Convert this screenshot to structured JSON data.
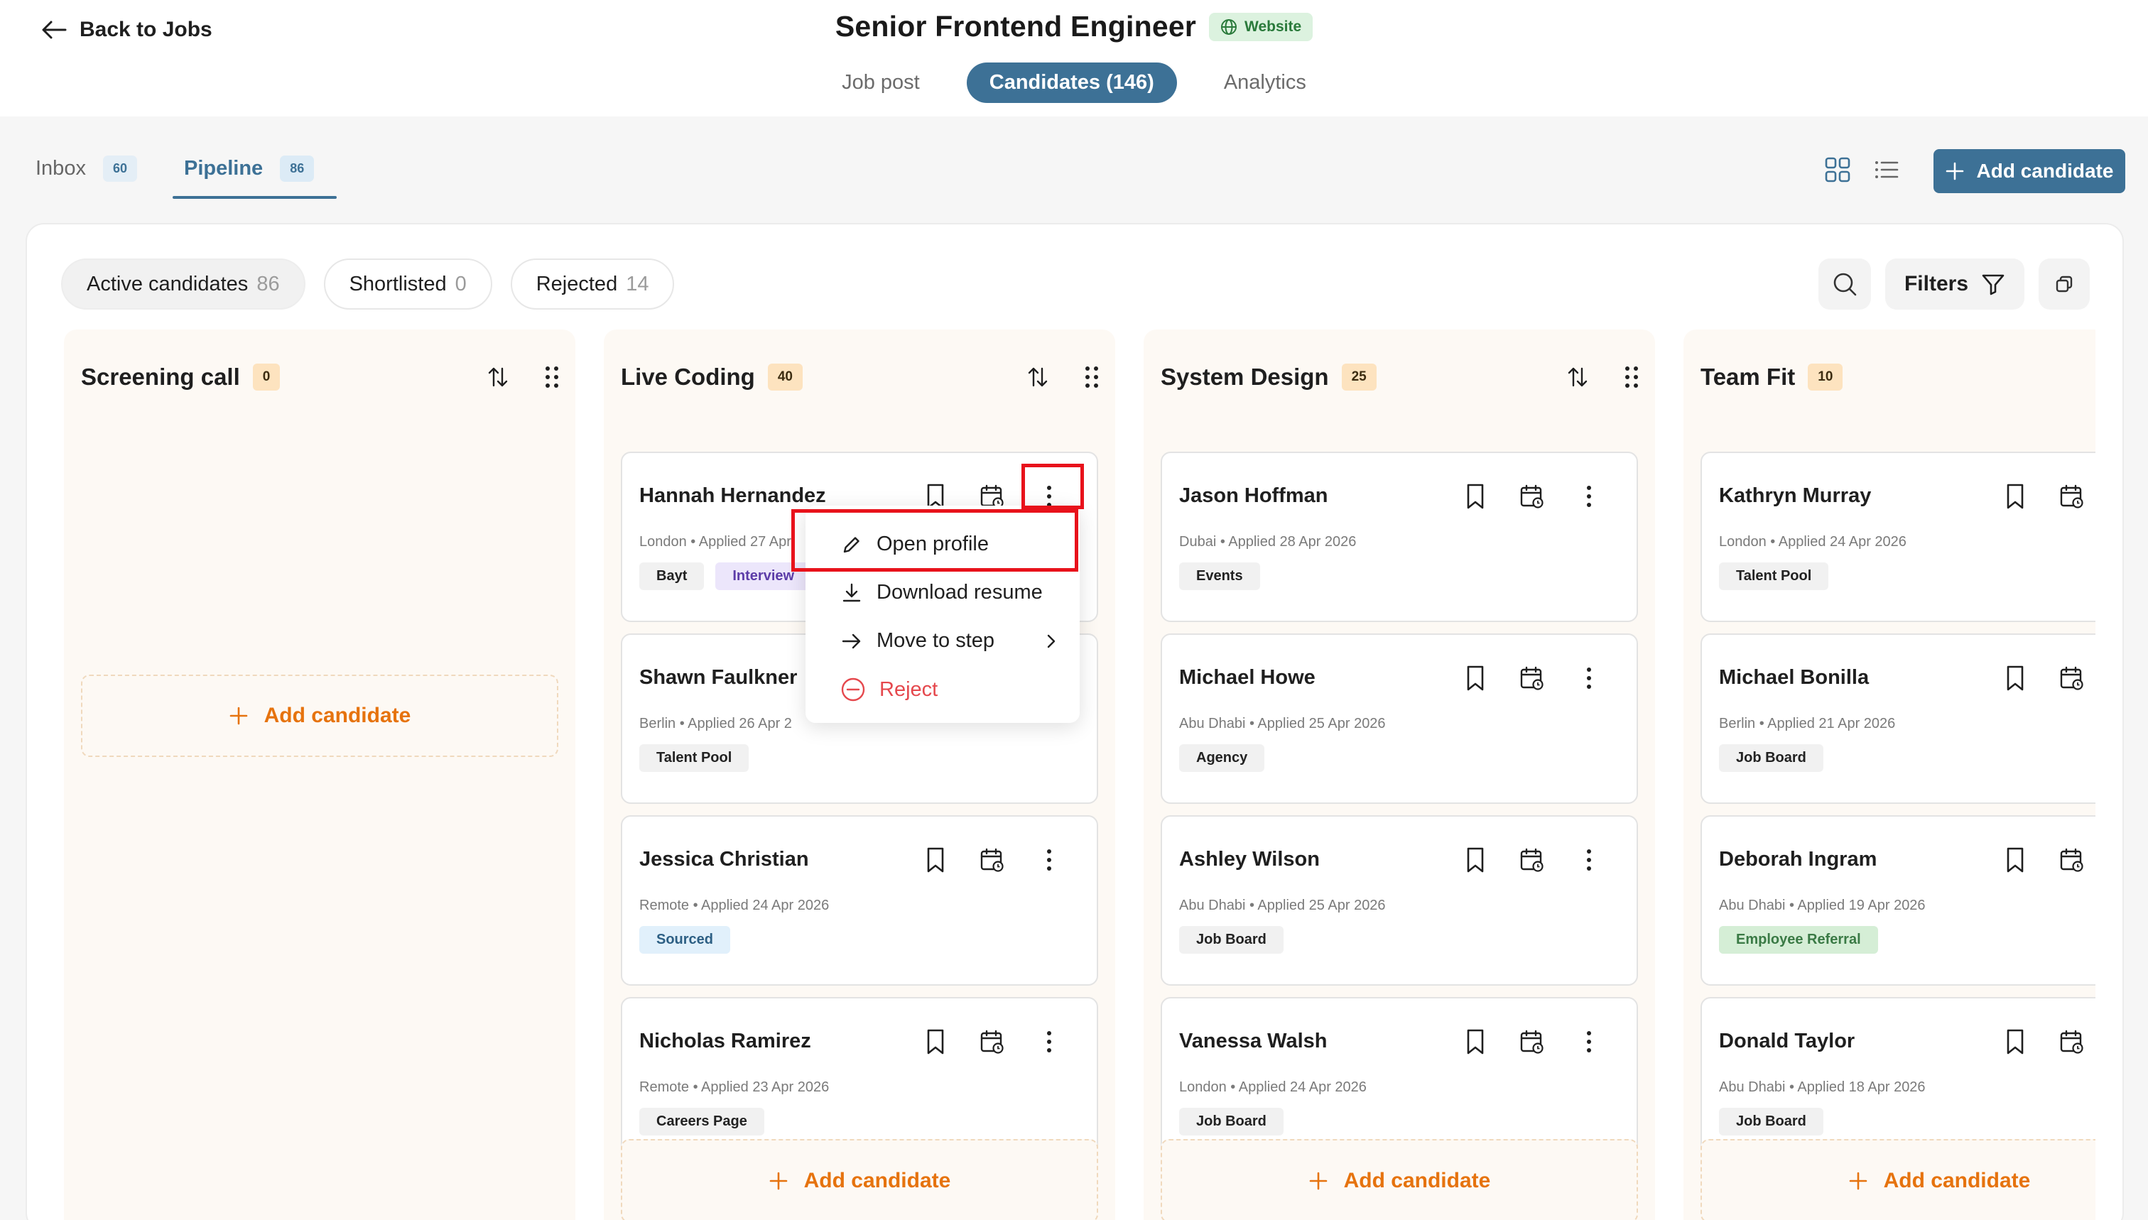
{
  "header": {
    "back_label": "Back to Jobs",
    "job_title": "Senior Frontend Engineer",
    "badge_label": "Website",
    "tabs": [
      {
        "label": "Job post"
      },
      {
        "label": "Candidates (146)"
      },
      {
        "label": "Analytics"
      }
    ],
    "active_tab": "Candidates (146)"
  },
  "subtabs": [
    {
      "label": "Inbox",
      "count": "60"
    },
    {
      "label": "Pipeline",
      "count": "86"
    }
  ],
  "toolbar": {
    "add_candidate_label": "Add candidate",
    "filters_label": "Filters"
  },
  "filters": [
    {
      "label": "Active candidates",
      "count": "86"
    },
    {
      "label": "Shortlisted",
      "count": "0"
    },
    {
      "label": "Rejected",
      "count": "14"
    }
  ],
  "columns": [
    {
      "title": "Screening call",
      "count": "0",
      "empty_add_label": "Add candidate",
      "candidates": []
    },
    {
      "title": "Live Coding",
      "count": "40",
      "add_label": "Add candidate",
      "candidates": [
        {
          "name": "Hannah Hernandez",
          "meta": "London • Applied 27 Apr",
          "tags": [
            "Bayt",
            "Interview"
          ]
        },
        {
          "name": "Shawn Faulkner",
          "meta": "Berlin • Applied 26 Apr 2",
          "tags": [
            "Talent Pool"
          ]
        },
        {
          "name": "Jessica Christian",
          "meta": "Remote • Applied 24 Apr 2026",
          "tags": [
            "Sourced"
          ]
        },
        {
          "name": "Nicholas Ramirez",
          "meta": "Remote • Applied 23 Apr 2026",
          "tags": [
            "Careers Page"
          ]
        }
      ]
    },
    {
      "title": "System Design",
      "count": "25",
      "add_label": "Add candidate",
      "candidates": [
        {
          "name": "Jason Hoffman",
          "meta": "Dubai • Applied 28 Apr 2026",
          "tags": [
            "Events"
          ]
        },
        {
          "name": "Michael Howe",
          "meta": "Abu Dhabi • Applied 25 Apr 2026",
          "tags": [
            "Agency"
          ]
        },
        {
          "name": "Ashley Wilson",
          "meta": "Abu Dhabi • Applied 25 Apr 2026",
          "tags": [
            "Job Board"
          ]
        },
        {
          "name": "Vanessa Walsh",
          "meta": "London • Applied 24 Apr 2026",
          "tags": [
            "Job Board"
          ]
        }
      ]
    },
    {
      "title": "Team Fit",
      "count": "10",
      "add_label": "Add candidate",
      "candidates": [
        {
          "name": "Kathryn Murray",
          "meta": "London • Applied 24 Apr 2026",
          "tags": [
            "Talent Pool"
          ]
        },
        {
          "name": "Michael Bonilla",
          "meta": "Berlin • Applied 21 Apr 2026",
          "tags": [
            "Job Board"
          ]
        },
        {
          "name": "Deborah Ingram",
          "meta": "Abu Dhabi • Applied 19 Apr 2026",
          "tags": [
            "Employee Referral"
          ]
        },
        {
          "name": "Donald Taylor",
          "meta": "Abu Dhabi • Applied 18 Apr 2026",
          "tags": [
            "Job Board"
          ]
        }
      ]
    }
  ],
  "context_menu": {
    "items": [
      {
        "label": "Open profile",
        "icon": "pencil-icon"
      },
      {
        "label": "Download resume",
        "icon": "download-icon"
      },
      {
        "label": "Move to step",
        "icon": "arrow-right-icon"
      },
      {
        "label": "Reject",
        "icon": "minus-circle-icon"
      }
    ]
  },
  "colors": {
    "primary": "#3d7196",
    "accent_orange": "#e6730e",
    "reject_red": "#e5484d",
    "highlight_red": "#e8121b"
  }
}
